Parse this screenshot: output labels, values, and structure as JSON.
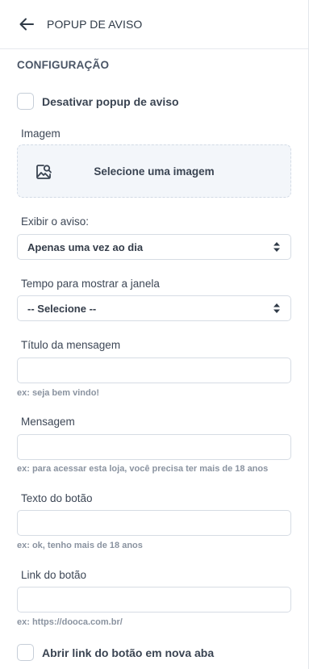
{
  "header": {
    "title": "POPUP DE AVISO",
    "back_icon": "arrow-left-icon"
  },
  "section": {
    "title": "CONFIGURAÇÃO"
  },
  "disable_popup": {
    "label": "Desativar popup de aviso",
    "checked": false
  },
  "image": {
    "label": "Imagem",
    "dropzone_text": "Selecione uma imagem",
    "icon": "image-search-icon"
  },
  "display": {
    "label": "Exibir o aviso:",
    "selected": "Apenas uma vez ao dia"
  },
  "delay": {
    "label": "Tempo para mostrar a janela",
    "selected": "-- Selecione --"
  },
  "message_title": {
    "label": "Título da mensagem",
    "value": "",
    "hint": "ex: seja bem vindo!"
  },
  "message": {
    "label": "Mensagem",
    "value": "",
    "hint": "ex: para acessar esta loja, você precisa ter mais de 18 anos"
  },
  "button_text": {
    "label": "Texto do botão",
    "value": "",
    "hint": "ex: ok, tenho mais de 18 anos"
  },
  "button_link": {
    "label": "Link do botão",
    "value": "",
    "hint": "ex: https://dooca.com.br/"
  },
  "new_tab": {
    "label": "Abrir link do botão em nova aba",
    "checked": false
  },
  "colors": {
    "text": "#2f3a47",
    "border": "#d6dce4",
    "dropzone_bg": "#f3f6fa",
    "hint": "#8a93a0"
  }
}
